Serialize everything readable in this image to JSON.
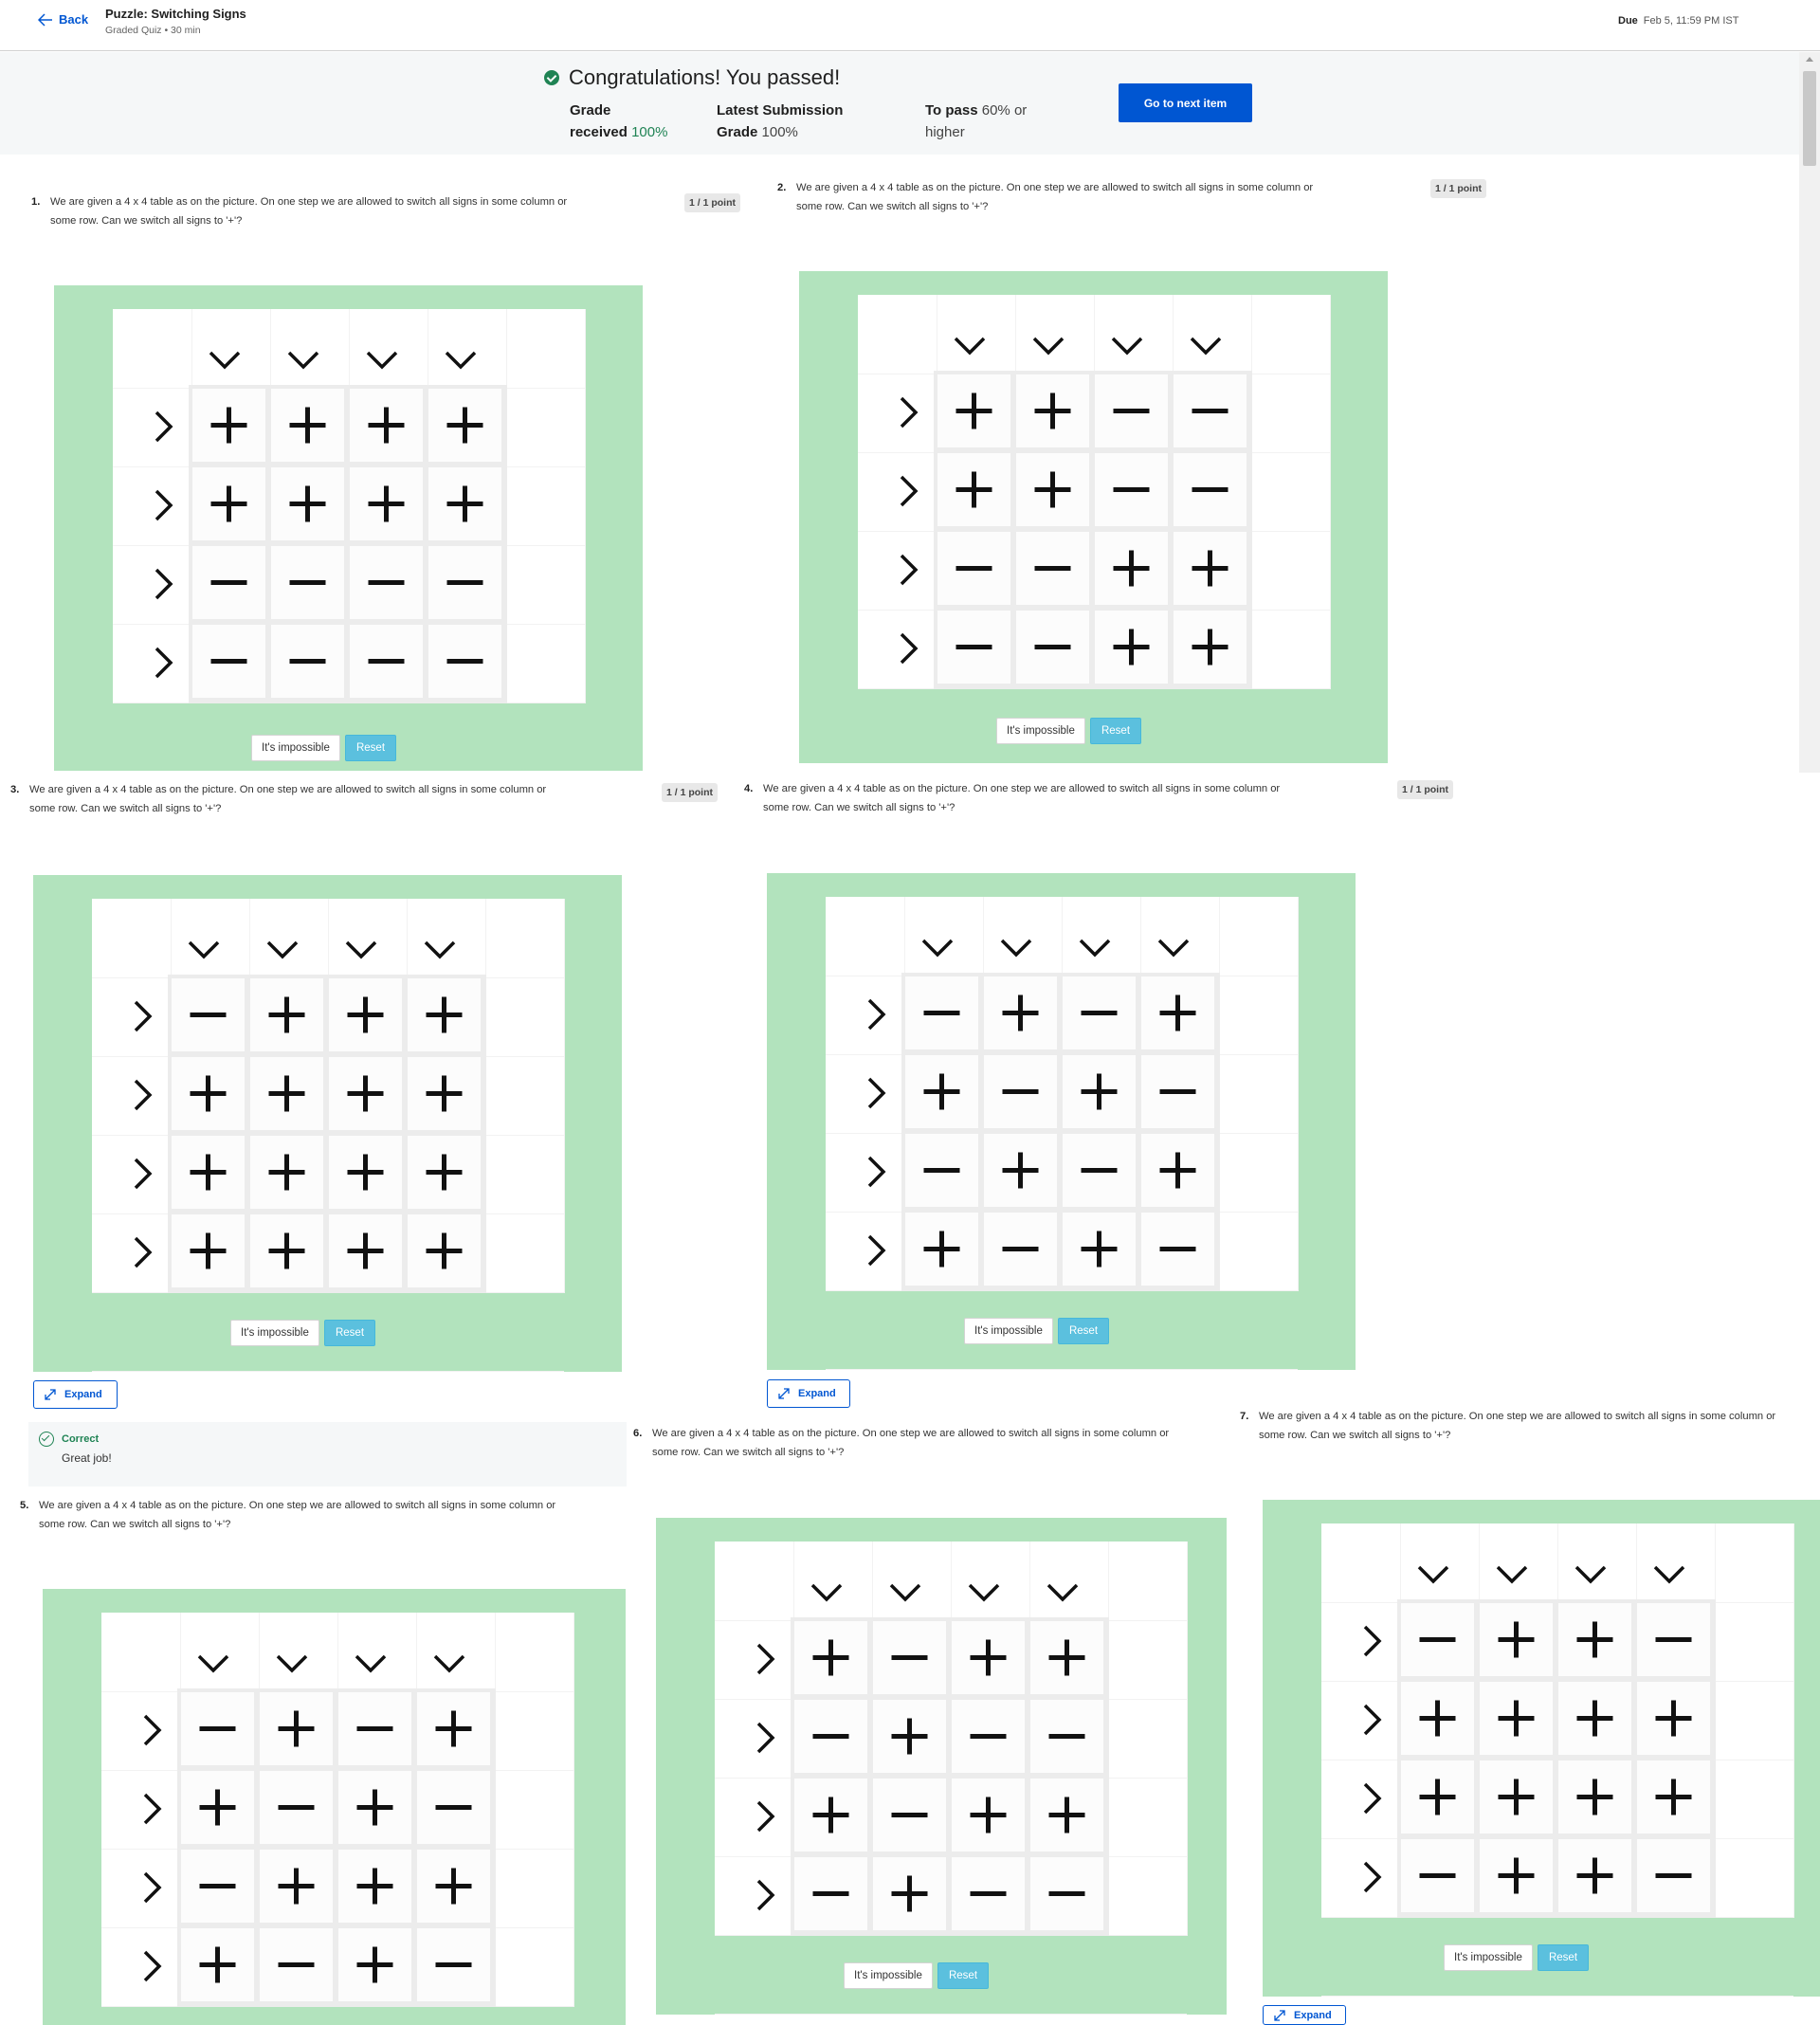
{
  "header": {
    "back_label": "Back",
    "title": "Puzzle: Switching Signs",
    "subtitle": "Graded Quiz • 30 min",
    "due_label": "Due",
    "due_value": "Feb 5, 11:59 PM IST"
  },
  "banner": {
    "title": "Congratulations! You passed!",
    "grade_label": "Grade",
    "grade_received_label": "received",
    "grade_received_value": "100%",
    "latest_label_1": "Latest Submission",
    "latest_label_2": "Grade",
    "latest_value": "100%",
    "to_pass_label": "To pass",
    "to_pass_value": "60% or",
    "to_pass_tail": "higher",
    "next_button": "Go to next item"
  },
  "question_text_1": "We are given a 4 x 4 table as on the picture. On one step we are allowed to switch all signs in some column or",
  "question_text_2": "some row. Can we switch all signs to '+'?",
  "points_label": "1 / 1 point",
  "impossible_label": "It's impossible",
  "reset_label": "Reset",
  "expand_label": "Expand",
  "feedback": {
    "title": "Correct",
    "body": "Great job!"
  },
  "questions": [
    {
      "number": "1.",
      "grid": [
        [
          "+",
          "+",
          "+",
          "+"
        ],
        [
          "+",
          "+",
          "+",
          "+"
        ],
        [
          "-",
          "-",
          "-",
          "-"
        ],
        [
          "-",
          "-",
          "-",
          "-"
        ]
      ]
    },
    {
      "number": "2.",
      "grid": [
        [
          "+",
          "+",
          "-",
          "-"
        ],
        [
          "+",
          "+",
          "-",
          "-"
        ],
        [
          "-",
          "-",
          "+",
          "+"
        ],
        [
          "-",
          "-",
          "+",
          "+"
        ]
      ]
    },
    {
      "number": "3.",
      "grid": [
        [
          "-",
          "+",
          "+",
          "+"
        ],
        [
          "+",
          "+",
          "+",
          "+"
        ],
        [
          "+",
          "+",
          "+",
          "+"
        ],
        [
          "+",
          "+",
          "+",
          "+"
        ]
      ]
    },
    {
      "number": "4.",
      "grid": [
        [
          "-",
          "+",
          "-",
          "+"
        ],
        [
          "+",
          "-",
          "+",
          "-"
        ],
        [
          "-",
          "+",
          "-",
          "+"
        ],
        [
          "+",
          "-",
          "+",
          "-"
        ]
      ]
    },
    {
      "number": "5.",
      "grid": [
        [
          "-",
          "+",
          "-",
          "+"
        ],
        [
          "+",
          "-",
          "+",
          "-"
        ],
        [
          "-",
          "+",
          "+",
          "+"
        ],
        [
          "+",
          "-",
          "+",
          "-"
        ]
      ]
    },
    {
      "number": "6.",
      "grid": [
        [
          "+",
          "-",
          "+",
          "+"
        ],
        [
          "-",
          "+",
          "-",
          "-"
        ],
        [
          "+",
          "-",
          "+",
          "+"
        ],
        [
          "-",
          "+",
          "-",
          "-"
        ]
      ]
    },
    {
      "number": "7.",
      "grid": [
        [
          "-",
          "+",
          "+",
          "-"
        ],
        [
          "+",
          "+",
          "+",
          "+"
        ],
        [
          "+",
          "+",
          "+",
          "+"
        ],
        [
          "-",
          "+",
          "+",
          "-"
        ]
      ]
    }
  ]
}
